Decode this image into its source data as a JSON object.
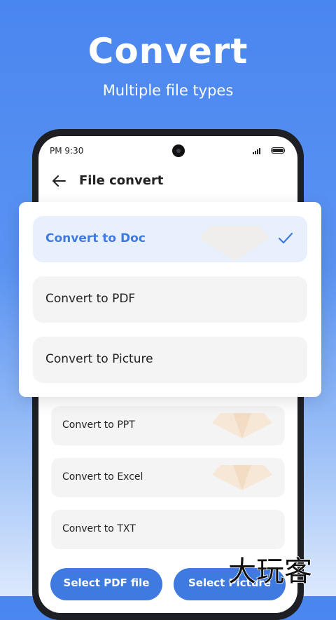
{
  "hero": {
    "title": "Convert",
    "subtitle": "Multiple file types"
  },
  "status_bar": {
    "time": "PM 9:30"
  },
  "header": {
    "title": "File convert"
  },
  "popup": {
    "items": [
      {
        "label": "Convert to Doc",
        "selected": true
      },
      {
        "label": "Convert to PDF",
        "selected": false
      },
      {
        "label": "Convert to Picture",
        "selected": false
      }
    ]
  },
  "list": {
    "items": [
      {
        "label": "Convert to PPT"
      },
      {
        "label": "Convert to Excel"
      },
      {
        "label": "Convert to TXT"
      }
    ]
  },
  "buttons": {
    "select_pdf": "Select PDF file",
    "select_picture": "Select Picture"
  },
  "watermark": {
    "text": "大玩客"
  },
  "colors": {
    "accent": "#3f7ae0",
    "background": "#4a86f0",
    "selected_bg": "#e9f0fd"
  }
}
